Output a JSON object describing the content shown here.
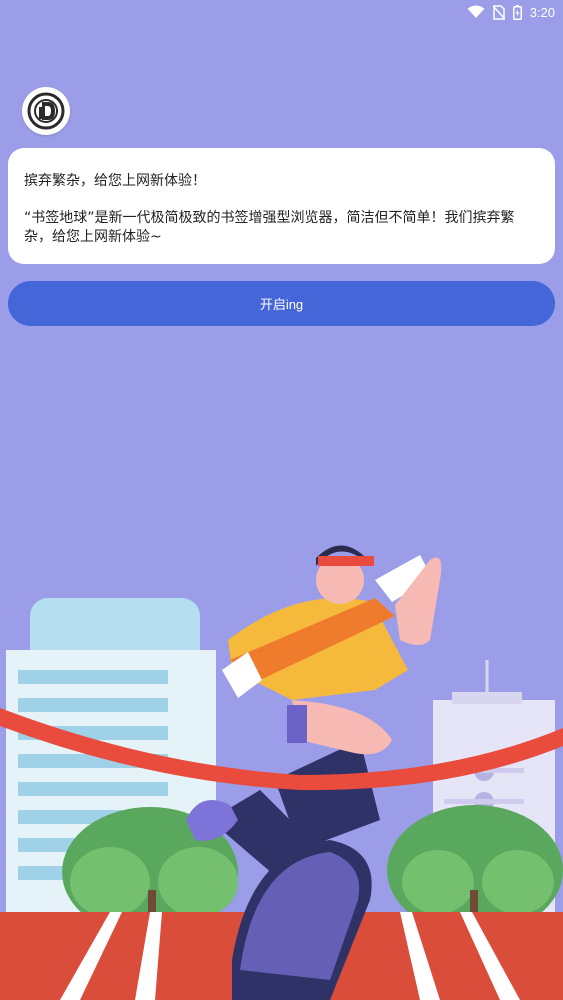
{
  "status_bar": {
    "time": "3:20",
    "icons": [
      "wifi-icon",
      "no-sim-icon",
      "battery-icon"
    ]
  },
  "app": {
    "logo_icon": "bookmark-earth-logo-icon"
  },
  "welcome": {
    "headline": "摈弃繁杂，给您上网新体验！",
    "description": "“书签地球”是新一代极简极致的书签增强型浏览器，简洁但不简单！我们摈弃繁杂，给您上网新体验~"
  },
  "start_button": {
    "label": "开启ing"
  },
  "illustration": {
    "subject": "runner-crossing-finish-line",
    "colors": {
      "background": "#9b9de8",
      "button": "#4466d8",
      "ribbon": "#e94b3c",
      "track": "#d94d3a",
      "shirt": "#f5b93c"
    }
  }
}
